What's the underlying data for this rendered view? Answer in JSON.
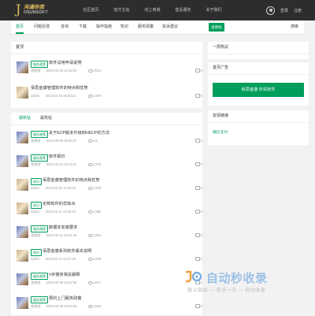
{
  "header": {
    "logo_cn": "沟通你我",
    "logo_letter": "J",
    "logo_en": "OSUNSOFT",
    "nav": [
      "社区首页",
      "官方主站",
      "线上商城",
      "售后服务",
      "关于我们"
    ],
    "login": "登录",
    "register": "注册"
  },
  "subnav": {
    "items": [
      "首页",
      "问题反馈",
      "咨询",
      "下载",
      "操作指南",
      "知识",
      "服务政策",
      "投诉建议"
    ],
    "active_index": 0,
    "post_button": "发新帖",
    "search": "搜索"
  },
  "featured": {
    "heading": "置顶",
    "posts": [
      {
        "badge": "服务政策",
        "title": "软件试用申请说明",
        "author": "渔歌宫",
        "date": "2022-02-15 13:33:34",
        "views": "2021",
        "comments": "0"
      },
      {
        "badge": "",
        "title": "佰思金康管理软件的特点和优势",
        "author": "admin",
        "date": "2022-02-15 16:30:11",
        "views": "1379",
        "comments": "0"
      }
    ]
  },
  "feed": {
    "tabs": [
      "最新帖",
      "最热帖"
    ],
    "active_tab": 0,
    "posts": [
      {
        "badge": "服务政策",
        "title": "关于ECP版本升级到HECP的方法",
        "author": "渔歌宫",
        "date": "2024-09-09 00:40:37",
        "views": "15",
        "comments": "0"
      },
      {
        "badge": "服务政策",
        "title": "软件报价",
        "author": "渔歌宫",
        "date": "2022-02-14 22:13:37",
        "views": "1378",
        "comments": "0"
      },
      {
        "badge": "知识",
        "title": "佰思金康管理软件的特点和优势",
        "author": "admin",
        "date": "2022-02-15 16:30:11",
        "views": "1378",
        "comments": "0"
      },
      {
        "badge": "知识",
        "title": "定制软件的优缺点",
        "author": "admin",
        "date": "2022-02-11 13:08:47",
        "views": "1385",
        "comments": "0"
      },
      {
        "badge": "服务政策",
        "title": "数据本安装要求",
        "author": "渔歌宫",
        "date": "2022-02-11 13:24:28",
        "views": "1664",
        "comments": "0"
      },
      {
        "badge": "知识",
        "title": "佰思金康系列软件版本说明",
        "author": "admin",
        "date": "2022-02-14 12:57:29",
        "views": "1378",
        "comments": "0"
      },
      {
        "badge": "服务政策",
        "title": "VIP服务相关解释",
        "author": "渔歌宫",
        "date": "2022-02-09 13:57:50",
        "views": "1671",
        "comments": "0"
      },
      {
        "badge": "服务政策",
        "title": "预约上门服务政策",
        "author": "渔歌宫",
        "date": "2022-02-09 16:33:04",
        "views": "1583",
        "comments": "0"
      }
    ]
  },
  "sidebar": {
    "week_heading": "一周热议",
    "ad_heading": "首页广告",
    "ad_button": "佰思金康 外贸软件",
    "links_heading": "友情链接",
    "links": [
      "微信支付"
    ]
  },
  "watermark": {
    "title": "自动秒收录",
    "subtitle": "做上链接 — 来访一次 — 自动收录"
  },
  "colors": {
    "accent": "#009e5b",
    "topbar": "#2d2d2d",
    "background": "#f2f2f2"
  }
}
